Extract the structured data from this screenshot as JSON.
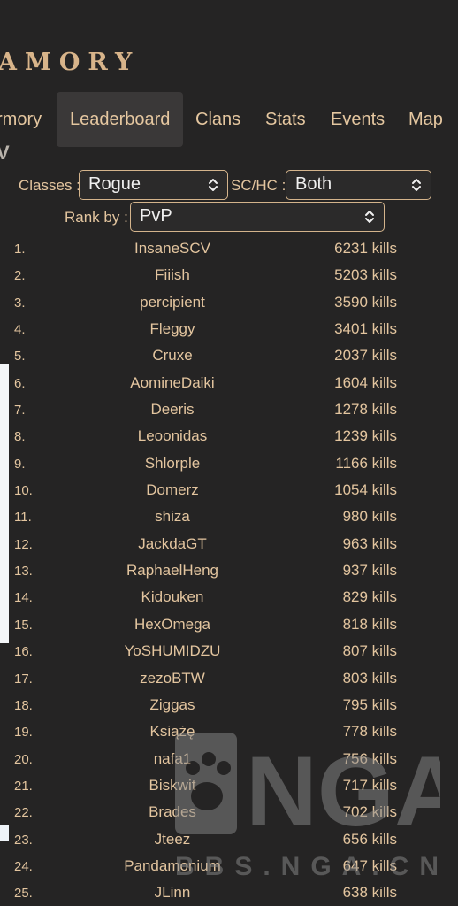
{
  "logo": {
    "text": "AMORY"
  },
  "nav": {
    "items": [
      {
        "label": "rmory",
        "active": false
      },
      {
        "label": "Leaderboard",
        "active": true
      },
      {
        "label": "Clans",
        "active": false
      },
      {
        "label": "Stats",
        "active": false
      },
      {
        "label": "Events",
        "active": false
      },
      {
        "label": "Map",
        "active": false
      }
    ]
  },
  "sub_label": "V",
  "filters": {
    "classes_label": "Classes :",
    "classes_value": "Rogue",
    "mode_label": "SC/HC :",
    "mode_value": "Both",
    "rank_label": "Rank by :",
    "rank_value": "PvP"
  },
  "leaderboard": [
    {
      "rank": "1.",
      "name": "InsaneSCV",
      "kills": "6231 kills"
    },
    {
      "rank": "2.",
      "name": "Fiiish",
      "kills": "5203 kills"
    },
    {
      "rank": "3.",
      "name": "percipient",
      "kills": "3590 kills"
    },
    {
      "rank": "4.",
      "name": "Fleggy",
      "kills": "3401 kills"
    },
    {
      "rank": "5.",
      "name": "Cruxe",
      "kills": "2037 kills"
    },
    {
      "rank": "6.",
      "name": "AomineDaiki",
      "kills": "1604 kills"
    },
    {
      "rank": "7.",
      "name": "Deeris",
      "kills": "1278 kills"
    },
    {
      "rank": "8.",
      "name": "Leoonidas",
      "kills": "1239 kills"
    },
    {
      "rank": "9.",
      "name": "Shlorple",
      "kills": "1166 kills"
    },
    {
      "rank": "10.",
      "name": "Domerz",
      "kills": "1054 kills"
    },
    {
      "rank": "11.",
      "name": "shiza",
      "kills": "980 kills"
    },
    {
      "rank": "12.",
      "name": "JackdaGT",
      "kills": "963 kills"
    },
    {
      "rank": "13.",
      "name": "RaphaelHeng",
      "kills": "937 kills"
    },
    {
      "rank": "14.",
      "name": "Kidouken",
      "kills": "829 kills"
    },
    {
      "rank": "15.",
      "name": "HexOmega",
      "kills": "818 kills"
    },
    {
      "rank": "16.",
      "name": "YoSHUMIDZU",
      "kills": "807 kills"
    },
    {
      "rank": "17.",
      "name": "zezoBTW",
      "kills": "803 kills"
    },
    {
      "rank": "18.",
      "name": "Ziggas",
      "kills": "795 kills"
    },
    {
      "rank": "19.",
      "name": "Książę",
      "kills": "778 kills"
    },
    {
      "rank": "20.",
      "name": "nafa1",
      "kills": "756 kills"
    },
    {
      "rank": "21.",
      "name": "Biskwit",
      "kills": "717 kills"
    },
    {
      "rank": "22.",
      "name": "Brades",
      "kills": "702 kills"
    },
    {
      "rank": "23.",
      "name": "Jteez",
      "kills": "656 kills"
    },
    {
      "rank": "24.",
      "name": "Pandamonium",
      "kills": "647 kills"
    },
    {
      "rank": "25.",
      "name": "JLinn",
      "kills": "638 kills"
    }
  ],
  "watermark": {
    "text": "BBS.NGA.CN",
    "logo_text": "NGA"
  },
  "colors": {
    "background": "#252424",
    "accent_gold": "#e3c59f",
    "select_border": "#d4b48c",
    "nav_active_bg": "#3a3838"
  }
}
